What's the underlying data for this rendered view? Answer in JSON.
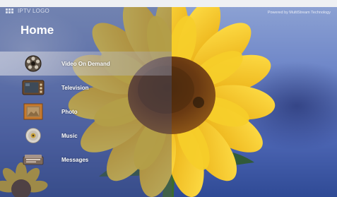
{
  "header": {
    "logo_text": "IPTV LOGO",
    "powered_by": "Powered by MultiStream Technology"
  },
  "page": {
    "title": "Home"
  },
  "menu": {
    "items": [
      {
        "label": "Video On Demand",
        "icon": "film-reel-icon",
        "selected": true
      },
      {
        "label": "Television",
        "icon": "television-icon",
        "selected": false
      },
      {
        "label": "Photo",
        "icon": "photo-frame-icon",
        "selected": false
      },
      {
        "label": "Music",
        "icon": "music-disc-icon",
        "selected": false
      },
      {
        "label": "Messages",
        "icon": "messages-icon",
        "selected": false
      }
    ]
  },
  "colors": {
    "sky": "#4d66b4",
    "flower_petal": "#f2c21b",
    "flower_center": "#6a3a12",
    "selection_highlight": "#d9d9df"
  }
}
